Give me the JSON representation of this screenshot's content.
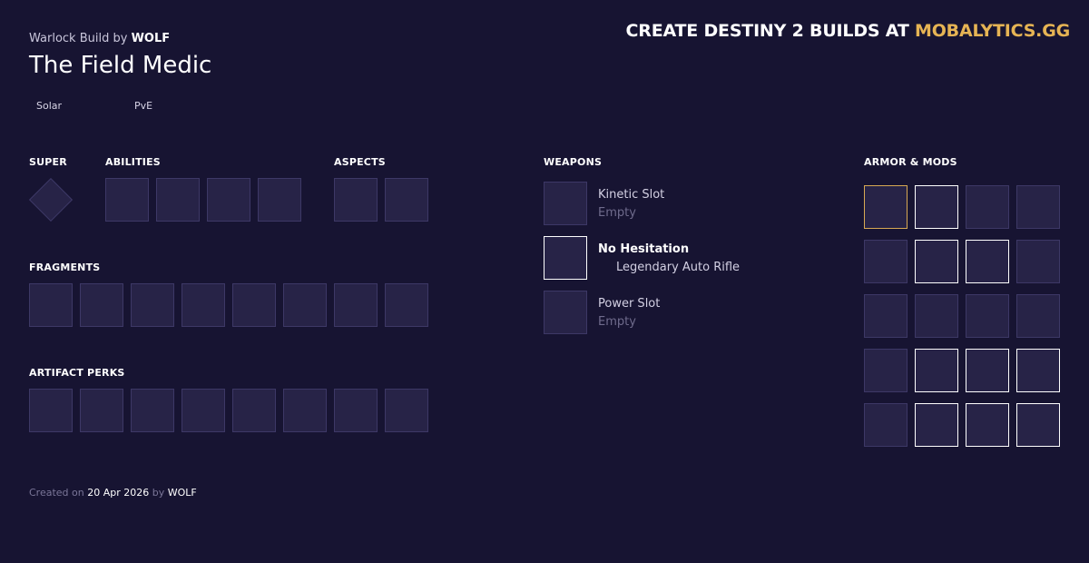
{
  "header": {
    "class_build": "Warlock Build",
    "by_word": "by",
    "author": "WOLF",
    "title": "The Field Medic",
    "tags": [
      "Solar",
      "PvE"
    ],
    "promo_text": "CREATE DESTINY 2 BUILDS AT",
    "promo_brand": "MOBALYTICS.GG"
  },
  "sections": {
    "super": "SUPER",
    "abilities": "ABILITIES",
    "aspects": "ASPECTS",
    "fragments": "FRAGMENTS",
    "artifact_perks": "ARTIFACT PERKS",
    "weapons": "WEAPONS",
    "armor_mods": "ARMOR & MODS"
  },
  "weapons": [
    {
      "name": "Kinetic Slot",
      "sub": "Empty"
    },
    {
      "name": "No Hesitation",
      "sub": "Legendary Auto Rifle"
    },
    {
      "name": "Power Slot",
      "sub": "Empty"
    }
  ],
  "footer": {
    "created_on": "Created on",
    "date": "20 Apr 2026",
    "by_word": "by",
    "author": "WOLF"
  },
  "colors": {
    "background": "#171432",
    "slot_fill": "#272347",
    "slot_border": "#3d3866",
    "accent_gold": "#e6b454"
  }
}
